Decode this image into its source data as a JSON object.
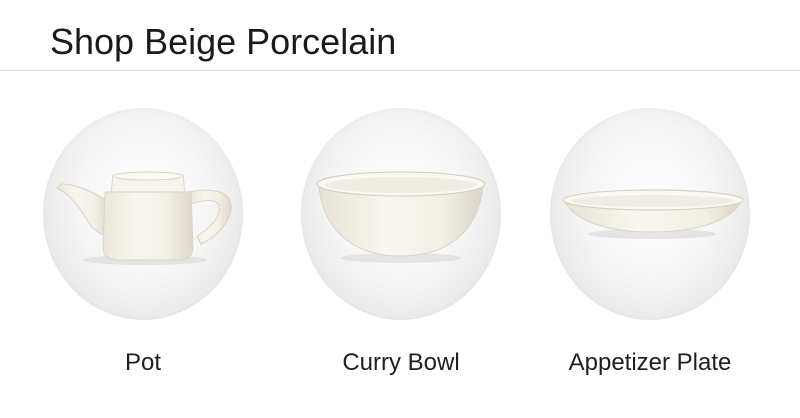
{
  "header": {
    "title": "Shop Beige Porcelain"
  },
  "products": [
    {
      "label": "Pot",
      "icon": "teapot-image"
    },
    {
      "label": "Curry Bowl",
      "icon": "bowl-image"
    },
    {
      "label": "Appetizer Plate",
      "icon": "plate-image"
    }
  ],
  "colors": {
    "porcelain": "#f4f1e8",
    "porcelain_shadow": "#ddd8cc",
    "divider": "#d8d8d8",
    "text": "#1a1a1a"
  }
}
